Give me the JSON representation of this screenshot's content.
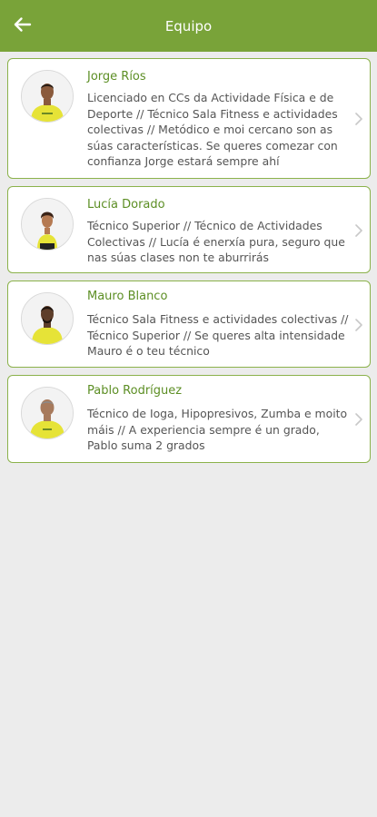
{
  "header": {
    "title": "Equipo",
    "back_icon": "arrow-left-icon"
  },
  "colors": {
    "appbar": "#79a339",
    "name": "#5c8e24",
    "card_border": "#8bb24b",
    "background": "#ececec",
    "shirt": "#e6e337"
  },
  "team": [
    {
      "name": "Jorge Ríos",
      "description": "Licenciado en CCs da Actividade Física e de Deporte // Técnico Sala Fitness e actividades colectivas // Metódico e moi cercano son as súas características. Se queres comezar con confianza Jorge estará sempre ahí"
    },
    {
      "name": "Lucía Dorado",
      "description": "Técnico Superior // Técnico de Actividades Colectivas // Lucía é enerxía pura, seguro que nas súas clases non te aburrirás"
    },
    {
      "name": "Mauro Blanco",
      "description": "Técnico Sala Fitness e actividades colectivas // Técnico Superior // Se queres alta intensidade Mauro é o teu técnico"
    },
    {
      "name": "Pablo Rodríguez",
      "description": "Técnico de Ioga, Hipopresivos, Zumba e moito máis // A experiencia sempre é un grado, Pablo suma 2 grados"
    }
  ]
}
